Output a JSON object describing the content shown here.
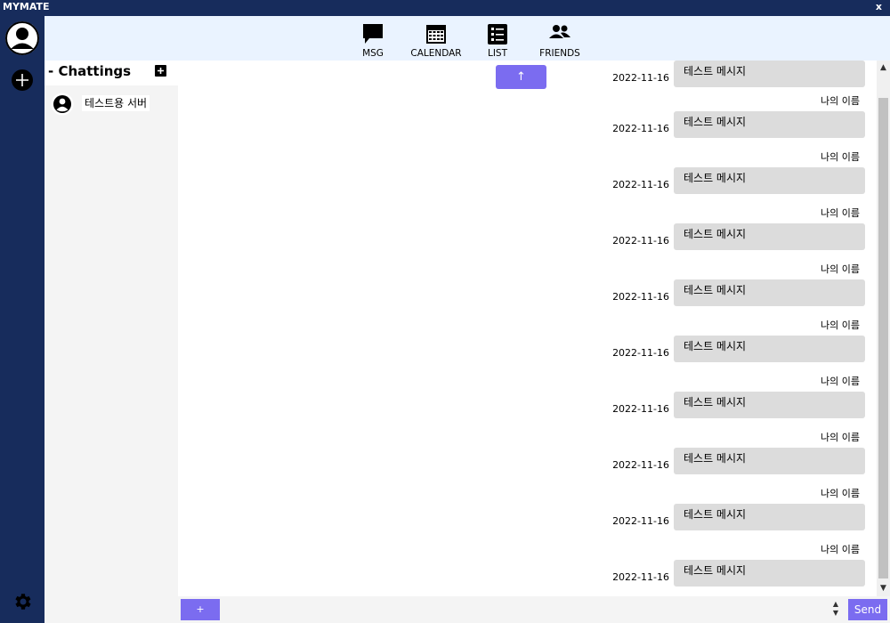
{
  "window": {
    "title": "MYMATE",
    "close_label": "x"
  },
  "nav": {
    "items": [
      {
        "label": "MSG",
        "icon": "message-icon"
      },
      {
        "label": "CALENDAR",
        "icon": "calendar-icon"
      },
      {
        "label": "LIST",
        "icon": "list-icon"
      },
      {
        "label": "FRIENDS",
        "icon": "friends-icon"
      }
    ]
  },
  "sidebar": {
    "title": "- Chattings",
    "rooms": [
      {
        "name": "테스트용 서버"
      }
    ]
  },
  "chat": {
    "scroll_up_label": "↑",
    "messages": [
      {
        "date": "2022-11-16",
        "text": "테스트 메시지",
        "sender": ""
      },
      {
        "date": "2022-11-16",
        "text": "테스트 메시지",
        "sender": "나의 이름"
      },
      {
        "date": "2022-11-16",
        "text": "테스트 메시지",
        "sender": "나의 이름"
      },
      {
        "date": "2022-11-16",
        "text": "테스트 메시지",
        "sender": "나의 이름"
      },
      {
        "date": "2022-11-16",
        "text": "테스트 메시지",
        "sender": "나의 이름"
      },
      {
        "date": "2022-11-16",
        "text": "테스트 메시지",
        "sender": "나의 이름"
      },
      {
        "date": "2022-11-16",
        "text": "테스트 메시지",
        "sender": "나의 이름"
      },
      {
        "date": "2022-11-16",
        "text": "테스트 메시지",
        "sender": "나의 이름"
      },
      {
        "date": "2022-11-16",
        "text": "테스트 메시지",
        "sender": "나의 이름"
      },
      {
        "date": "2022-11-16",
        "text": "테스트 메시지",
        "sender": "나의 이름"
      }
    ]
  },
  "input": {
    "attach_label": "+",
    "value": "",
    "send_label": "Send"
  },
  "colors": {
    "sidebar_bg": "#172c5c",
    "accent": "#7b6cf0",
    "nav_bg": "#eaf3ff",
    "bubble_bg": "#dcdcdc",
    "list_bg": "#f4f4f4"
  }
}
